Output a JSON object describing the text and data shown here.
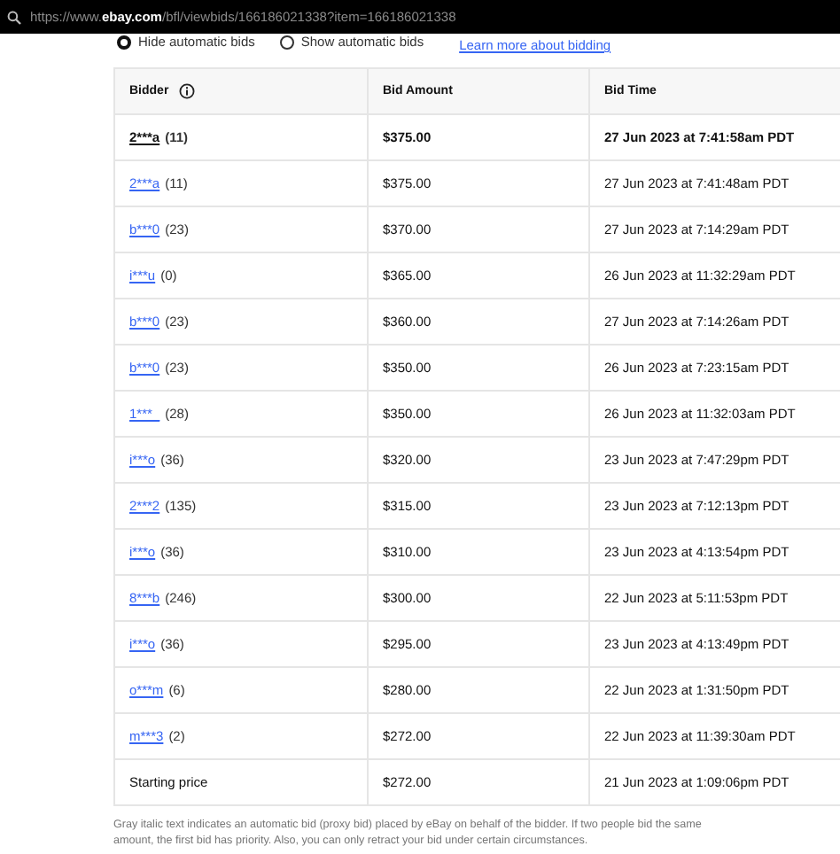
{
  "address_bar": {
    "url": "https://www.**ebay.com**/bfl/viewbids/166186021338?item=166186021338"
  },
  "options": [
    {
      "label": "Hide automatic bids",
      "selected": true
    },
    {
      "label": "Show automatic bids",
      "selected": false
    }
  ],
  "learn_link": "Learn more about bidding",
  "table": {
    "columns": [
      "Bidder",
      "Bid Amount",
      "Bid Time"
    ],
    "rows": [
      {
        "kind": "bidder",
        "bidder": "2***a",
        "count": "(11)",
        "amount": "$375.00",
        "time": "27 Jun 2023 at 7:41:58am PDT",
        "highest": true
      },
      {
        "kind": "bidder",
        "bidder": "2***a",
        "count": "(11)",
        "amount": "$375.00",
        "time": "27 Jun 2023 at 7:41:48am PDT",
        "highest": false
      },
      {
        "kind": "bidder",
        "bidder": "b***0",
        "count": "(23)",
        "amount": "$370.00",
        "time": "27 Jun 2023 at 7:14:29am PDT",
        "highest": false
      },
      {
        "kind": "bidder",
        "bidder": "i***u",
        "count": "(0)",
        "amount": "$365.00",
        "time": "26 Jun 2023 at 11:32:29am PDT",
        "highest": false
      },
      {
        "kind": "bidder",
        "bidder": "b***0",
        "count": "(23)",
        "amount": "$360.00",
        "time": "27 Jun 2023 at 7:14:26am PDT",
        "highest": false
      },
      {
        "kind": "bidder",
        "bidder": "b***0",
        "count": "(23)",
        "amount": "$350.00",
        "time": "26 Jun 2023 at 7:23:15am PDT",
        "highest": false
      },
      {
        "kind": "bidder",
        "bidder": "1***_",
        "count": "(28)",
        "amount": "$350.00",
        "time": "26 Jun 2023 at 11:32:03am PDT",
        "highest": false
      },
      {
        "kind": "bidder",
        "bidder": "i***o",
        "count": "(36)",
        "amount": "$320.00",
        "time": "23 Jun 2023 at 7:47:29pm PDT",
        "highest": false
      },
      {
        "kind": "bidder",
        "bidder": "2***2",
        "count": "(135)",
        "amount": "$315.00",
        "time": "23 Jun 2023 at 7:12:13pm PDT",
        "highest": false
      },
      {
        "kind": "bidder",
        "bidder": "i***o",
        "count": "(36)",
        "amount": "$310.00",
        "time": "23 Jun 2023 at 4:13:54pm PDT",
        "highest": false
      },
      {
        "kind": "bidder",
        "bidder": "8***b",
        "count": "(246)",
        "amount": "$300.00",
        "time": "22 Jun 2023 at 5:11:53pm PDT",
        "highest": false
      },
      {
        "kind": "bidder",
        "bidder": "i***o",
        "count": "(36)",
        "amount": "$295.00",
        "time": "23 Jun 2023 at 4:13:49pm PDT",
        "highest": false
      },
      {
        "kind": "bidder",
        "bidder": "o***m",
        "count": "(6)",
        "amount": "$280.00",
        "time": "22 Jun 2023 at 1:31:50pm PDT",
        "highest": false
      },
      {
        "kind": "bidder",
        "bidder": "m***3",
        "count": "(2)",
        "amount": "$272.00",
        "time": "22 Jun 2023 at 11:39:30am PDT",
        "highest": false
      },
      {
        "kind": "start",
        "label": "Starting price",
        "amount": "$272.00",
        "time": "21 Jun 2023 at 1:09:06pm PDT"
      }
    ]
  },
  "footnote": "Gray italic text indicates an automatic bid (proxy bid) placed by eBay on behalf of the bidder. If two people bid the same amount, the first bid has priority. Also, you can only retract your bid under certain circumstances."
}
